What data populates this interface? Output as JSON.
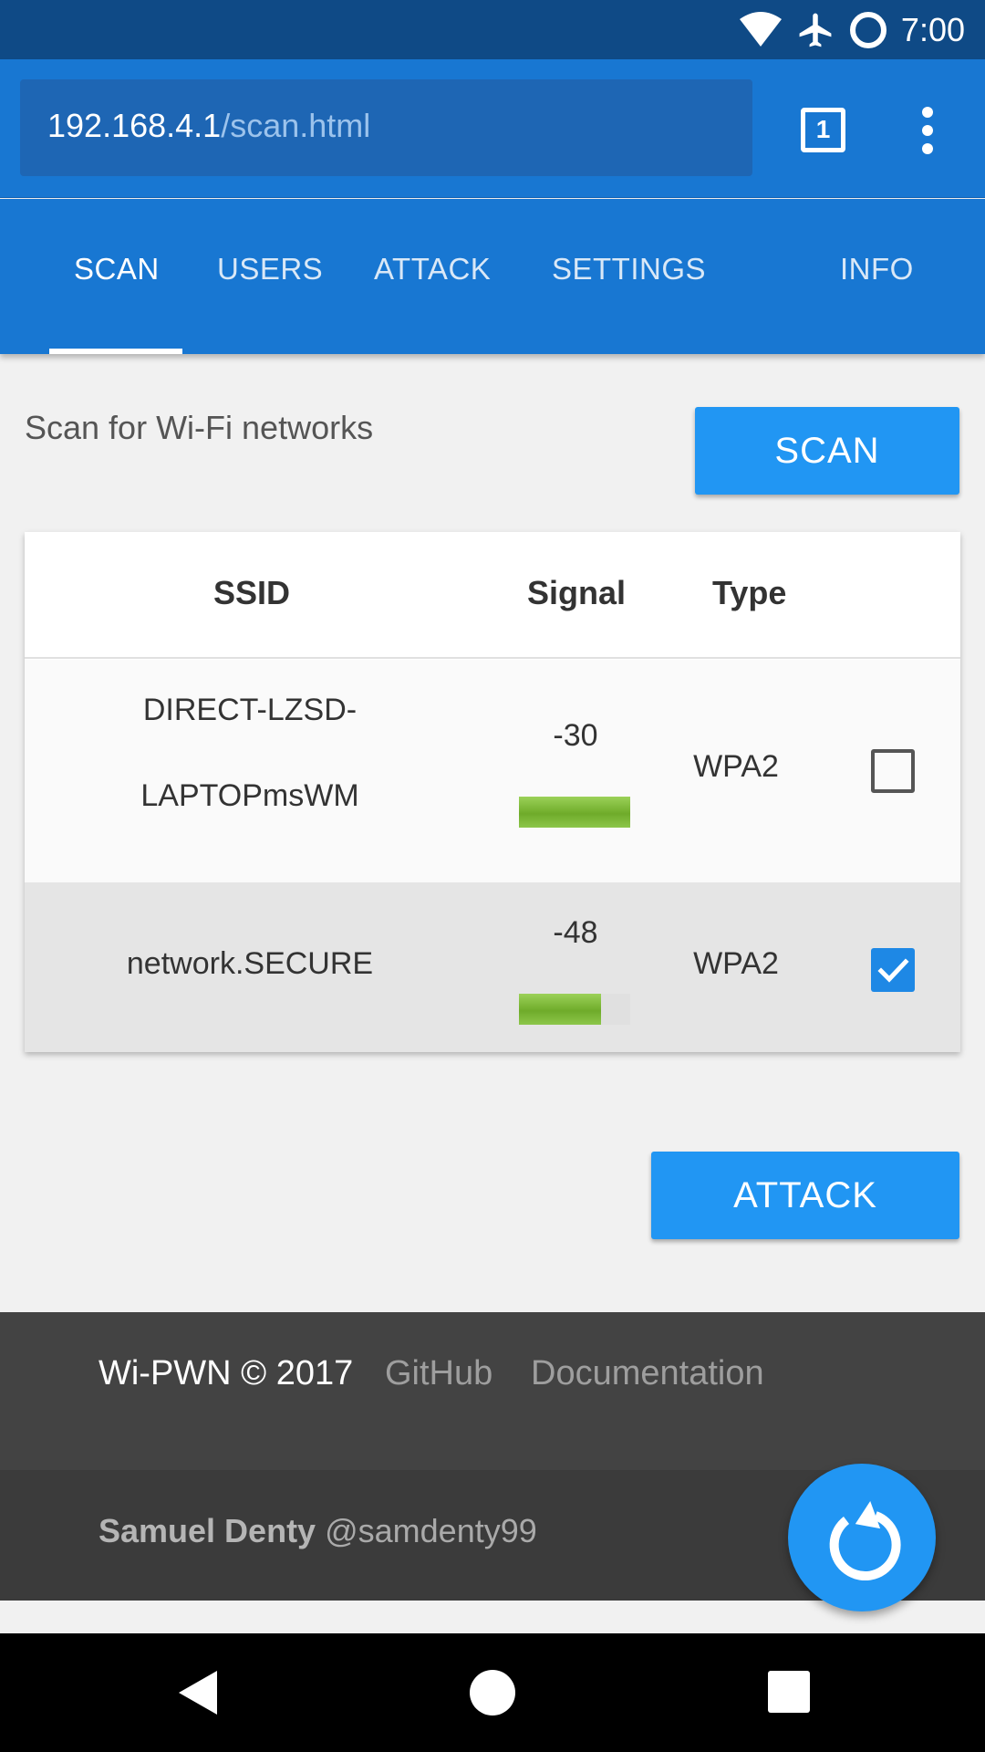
{
  "status_bar": {
    "time": "7:00",
    "icons": [
      "wifi-icon",
      "airplane-icon",
      "sync-circle-icon"
    ]
  },
  "browser": {
    "url_host": "192.168.4.1",
    "url_path": "/scan.html",
    "tab_count": "1"
  },
  "nav": {
    "tabs": [
      {
        "label": "SCAN",
        "active": true
      },
      {
        "label": "USERS",
        "active": false
      },
      {
        "label": "ATTACK",
        "active": false
      },
      {
        "label": "SETTINGS",
        "active": false
      },
      {
        "label": "INFO",
        "active": false
      }
    ]
  },
  "main": {
    "scan_label": "Scan for Wi-Fi networks",
    "scan_button": "SCAN",
    "attack_button": "ATTACK"
  },
  "table": {
    "headers": [
      "SSID",
      "Signal",
      "Type"
    ],
    "rows": [
      {
        "ssid_line1": "DIRECT-LZSD-",
        "ssid_line2": "LAPTOPmsWM",
        "signal": "-30",
        "signal_level": 1.0,
        "type": "WPA2",
        "selected": false
      },
      {
        "ssid": "network.SECURE",
        "signal": "-48",
        "signal_level": 0.74,
        "type": "WPA2",
        "selected": true
      }
    ]
  },
  "footer": {
    "copyright": "Wi-PWN © 2017",
    "github": "GitHub",
    "documentation": "Documentation",
    "author_name": "Samuel Denty",
    "author_handle": "@samdenty99"
  },
  "colors": {
    "primary": "#1877d2",
    "accent": "#2196f3",
    "signal_green": "#7cbd36"
  },
  "fab_icon": "refresh-icon"
}
